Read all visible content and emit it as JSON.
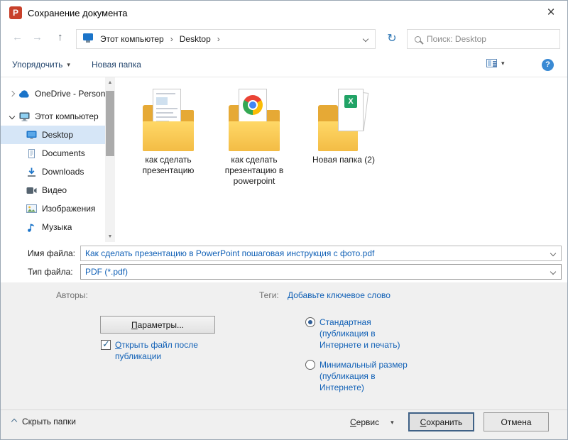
{
  "colors": {
    "link": "#1060b6",
    "toolbar-text": "#24466e",
    "selected-bg": "#d6e6f7",
    "folder-front": "#ffd867",
    "folder-back": "#e6a935",
    "help-blue": "#3a8ad4",
    "accent-save-border": "#3f6186"
  },
  "icons": {
    "app": "P",
    "close": "×",
    "back": "←",
    "forward": "→",
    "up": "↑",
    "refresh": "↻",
    "dropdown": "▾",
    "sep": "›",
    "help": "?",
    "check": "✓",
    "scroll_up": "▲",
    "scroll_down": "▼",
    "excel": "X"
  },
  "titlebar": {
    "title": "Сохранение документа"
  },
  "nav": {
    "breadcrumb": {
      "root": "Этот компьютер",
      "current": "Desktop"
    },
    "search_placeholder": "Поиск: Desktop"
  },
  "toolbar": {
    "organize": "Упорядочить",
    "new_folder": "Новая папка"
  },
  "sidebar": {
    "items": [
      {
        "label": "OneDrive - Person",
        "icon": "onedrive-cloud"
      },
      {
        "label": "Этот компьютер",
        "icon": "computer"
      },
      {
        "label": "Desktop",
        "icon": "desktop-monitor",
        "selected": true
      },
      {
        "label": "Documents",
        "icon": "documents"
      },
      {
        "label": "Downloads",
        "icon": "downloads"
      },
      {
        "label": "Видео",
        "icon": "videos"
      },
      {
        "label": "Изображения",
        "icon": "pictures"
      },
      {
        "label": "Музыка",
        "icon": "music"
      }
    ]
  },
  "files": [
    {
      "name": "как сделать презентацию",
      "icon": "folder-with-document"
    },
    {
      "name": "как сделать презентацию в powerpoint",
      "icon": "folder-with-chrome-file"
    },
    {
      "name": "Новая папка (2)",
      "icon": "folder-with-excel-file"
    }
  ],
  "form": {
    "filename_label": "Имя файла:",
    "filename_value": "Как сделать презентацию в PowerPoint пошаговая инструкция с фото.pdf",
    "filetype_label": "Тип файла:",
    "filetype_value": "PDF (*.pdf)",
    "authors_label": "Авторы:",
    "tags_label": "Теги:",
    "tags_add": "Добавьте ключевое слово",
    "options_ak": "П",
    "options_rest": "араметры...",
    "open_after_ak": "О",
    "open_after_rest": "ткрыть файл после публикации",
    "open_after_checked": true,
    "quality_standard": "Стандартная (публикация в Интернете и печать)",
    "quality_minimal": "Минимальный размер (публикация в Интернете)"
  },
  "footer": {
    "hide_folders": "Скрыть папки",
    "tools_ak": "С",
    "tools_rest": "ервис",
    "save_ak": "С",
    "save_rest": "охранить",
    "cancel": "Отмена"
  }
}
